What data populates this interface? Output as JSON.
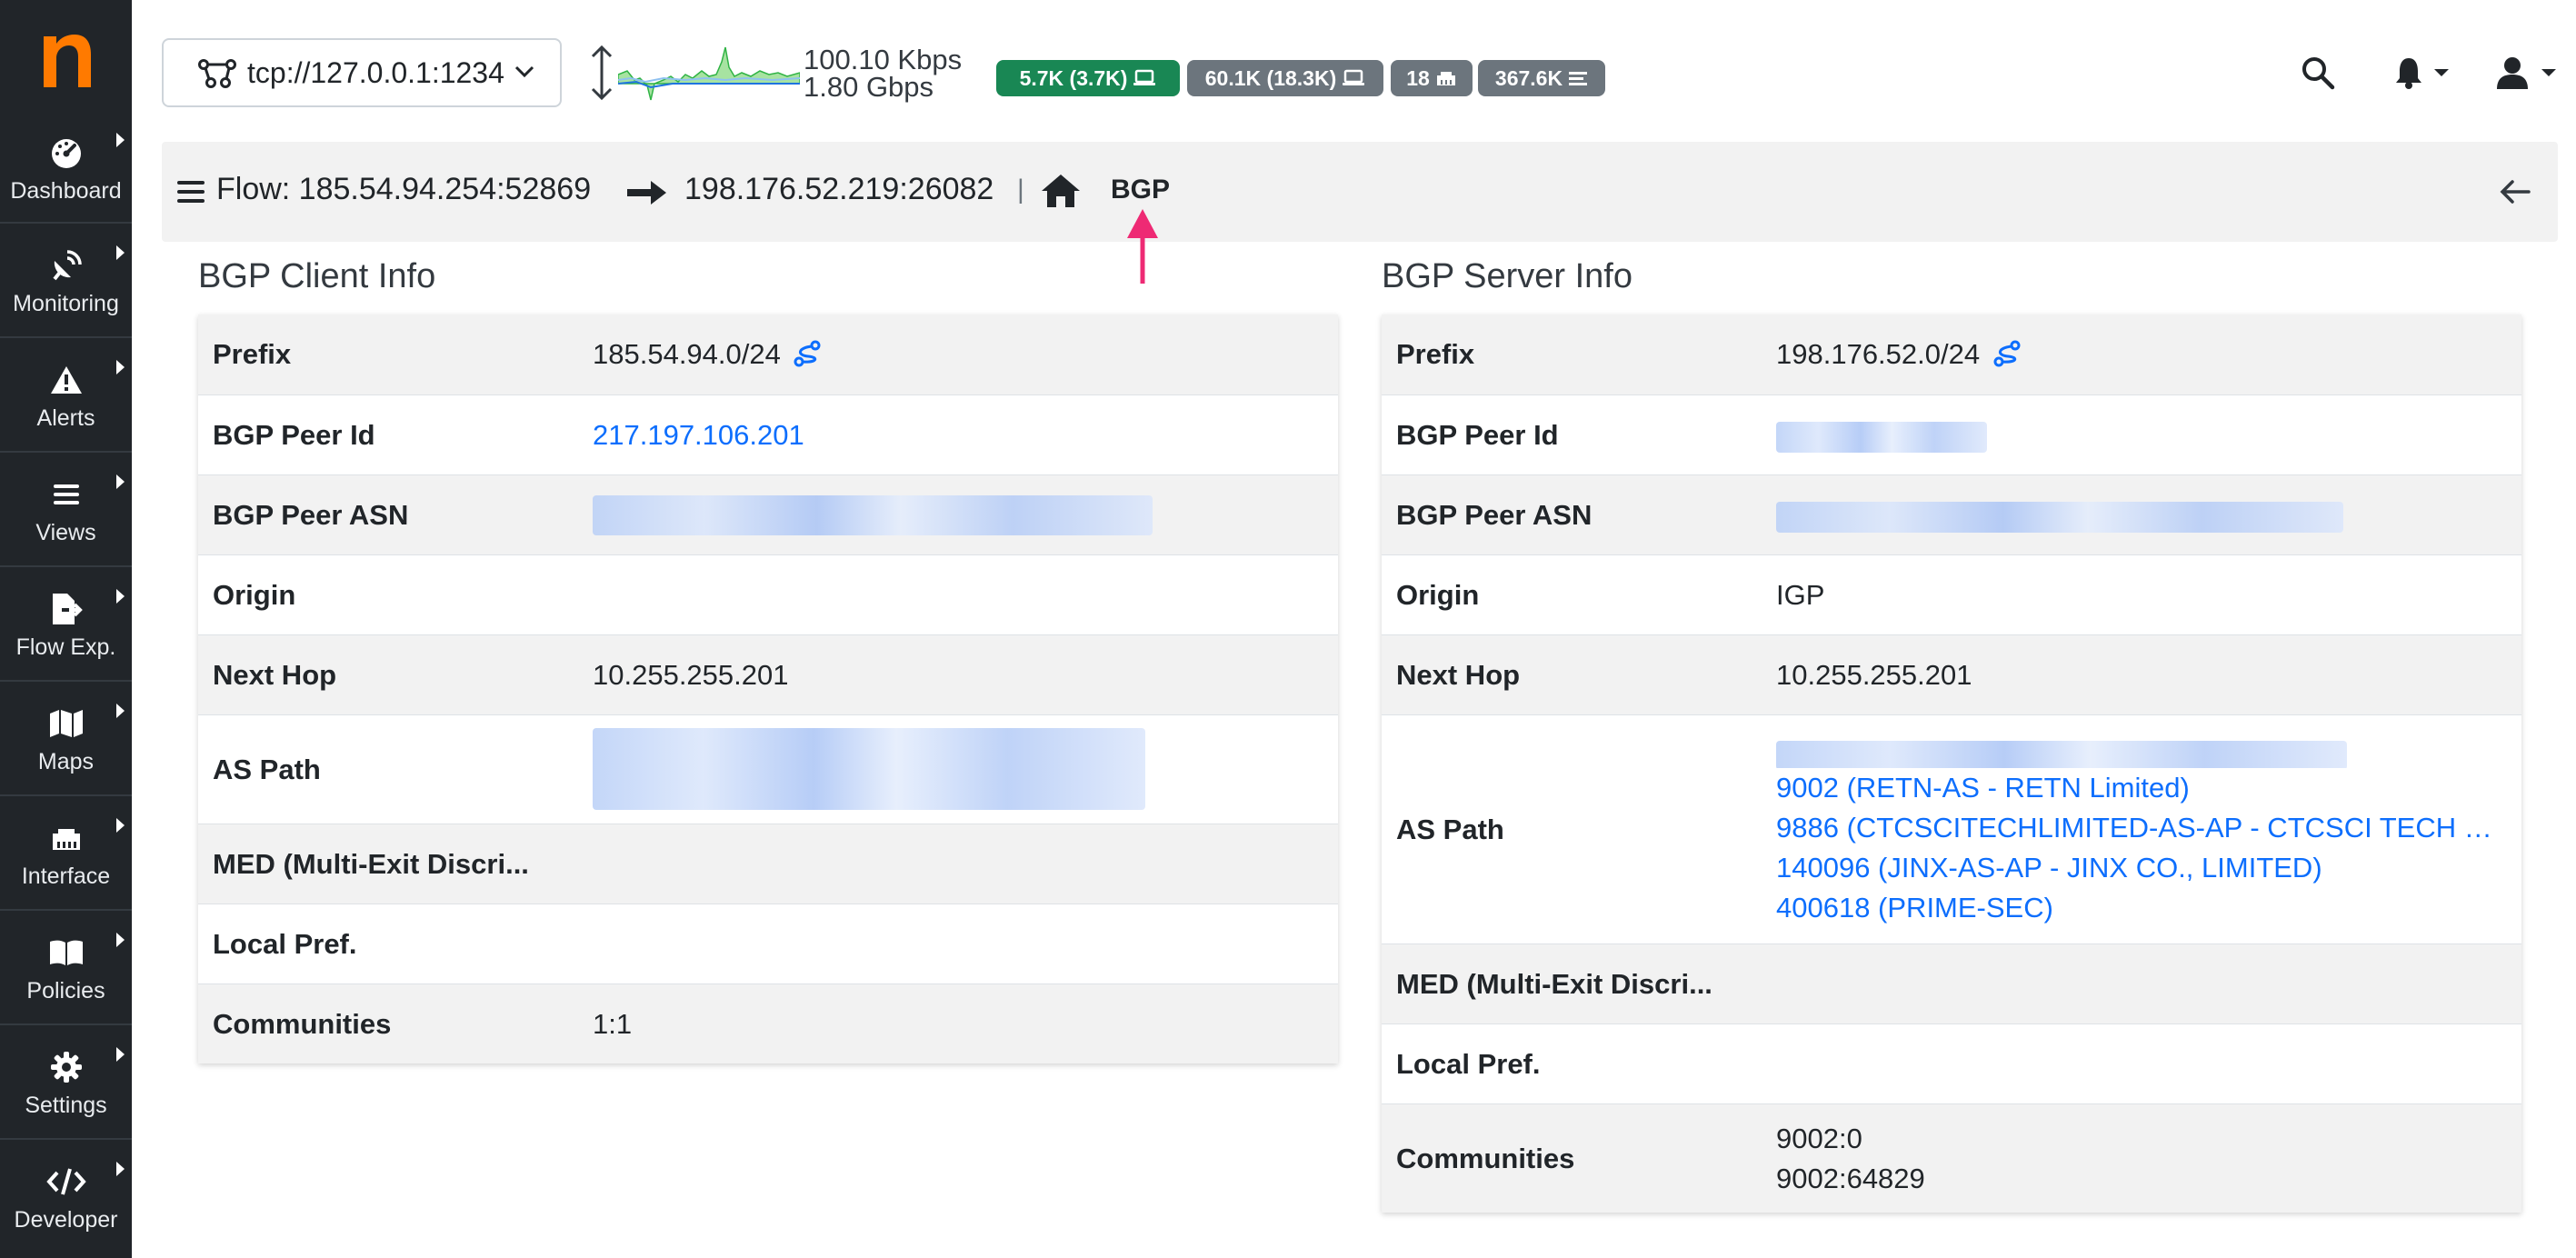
{
  "colors": {
    "sidebar": "#212529",
    "accent": "#ff7a00",
    "link": "#0d6efd",
    "badge_green": "#198754",
    "badge_gray": "#6c757d",
    "marker": "#ee2a74"
  },
  "sidebar": {
    "items": [
      {
        "label": "Dashboard",
        "icon": "gauge-icon"
      },
      {
        "label": "Monitoring",
        "icon": "satellite-dish-icon"
      },
      {
        "label": "Alerts",
        "icon": "warning-icon"
      },
      {
        "label": "Views",
        "icon": "bars-icon"
      },
      {
        "label": "Flow Exp.",
        "icon": "file-export-icon"
      },
      {
        "label": "Maps",
        "icon": "map-icon"
      },
      {
        "label": "Interface",
        "icon": "ethernet-icon"
      },
      {
        "label": "Policies",
        "icon": "book-icon"
      },
      {
        "label": "Settings",
        "icon": "gear-icon"
      },
      {
        "label": "Developer",
        "icon": "code-icon"
      }
    ]
  },
  "topbar": {
    "interface": "tcp://127.0.0.1:1234",
    "throughput_up": "100.10 Kbps",
    "throughput_down": "1.80 Gbps",
    "badges": [
      {
        "text": "5.7K (3.7K)",
        "icon": "laptop-icon"
      },
      {
        "text": "60.1K (18.3K)",
        "icon": "laptop-icon"
      },
      {
        "text": "18",
        "icon": "ethernet-icon"
      },
      {
        "text": "367.6K",
        "icon": "list-icon"
      }
    ]
  },
  "breadcrumb": {
    "flow_label": "Flow: 185.54.94.254:52869",
    "flow_dest": "198.176.52.219:26082",
    "separator": "|",
    "current": "BGP"
  },
  "client": {
    "title": "BGP Client Info",
    "labels": {
      "prefix": "Prefix",
      "peer_id": "BGP Peer Id",
      "peer_asn": "BGP Peer ASN",
      "origin": "Origin",
      "next_hop": "Next Hop",
      "as_path": "AS Path",
      "med": "MED (Multi-Exit Discri...",
      "local_pref": "Local Pref.",
      "communities": "Communities"
    },
    "prefix": "185.54.94.0/24",
    "peer_id": "217.197.106.201",
    "next_hop": "10.255.255.201",
    "communities": "1:1"
  },
  "server": {
    "title": "BGP Server Info",
    "labels": {
      "prefix": "Prefix",
      "peer_id": "BGP Peer Id",
      "peer_asn": "BGP Peer ASN",
      "origin": "Origin",
      "next_hop": "Next Hop",
      "as_path": "AS Path",
      "med": "MED (Multi-Exit Discri...",
      "local_pref": "Local Pref.",
      "communities": "Communities"
    },
    "prefix": "198.176.52.0/24",
    "origin": "IGP",
    "next_hop": "10.255.255.201",
    "as_path": [
      "9002 (RETN-AS - RETN Limited)",
      "9886 (CTCSCITECHLIMITED-AS-AP - CTCSCI TECH …",
      "140096 (JINX-AS-AP - JINX CO., LIMITED)",
      "400618 (PRIME-SEC)"
    ],
    "communities": [
      "9002:0",
      "9002:64829"
    ]
  }
}
